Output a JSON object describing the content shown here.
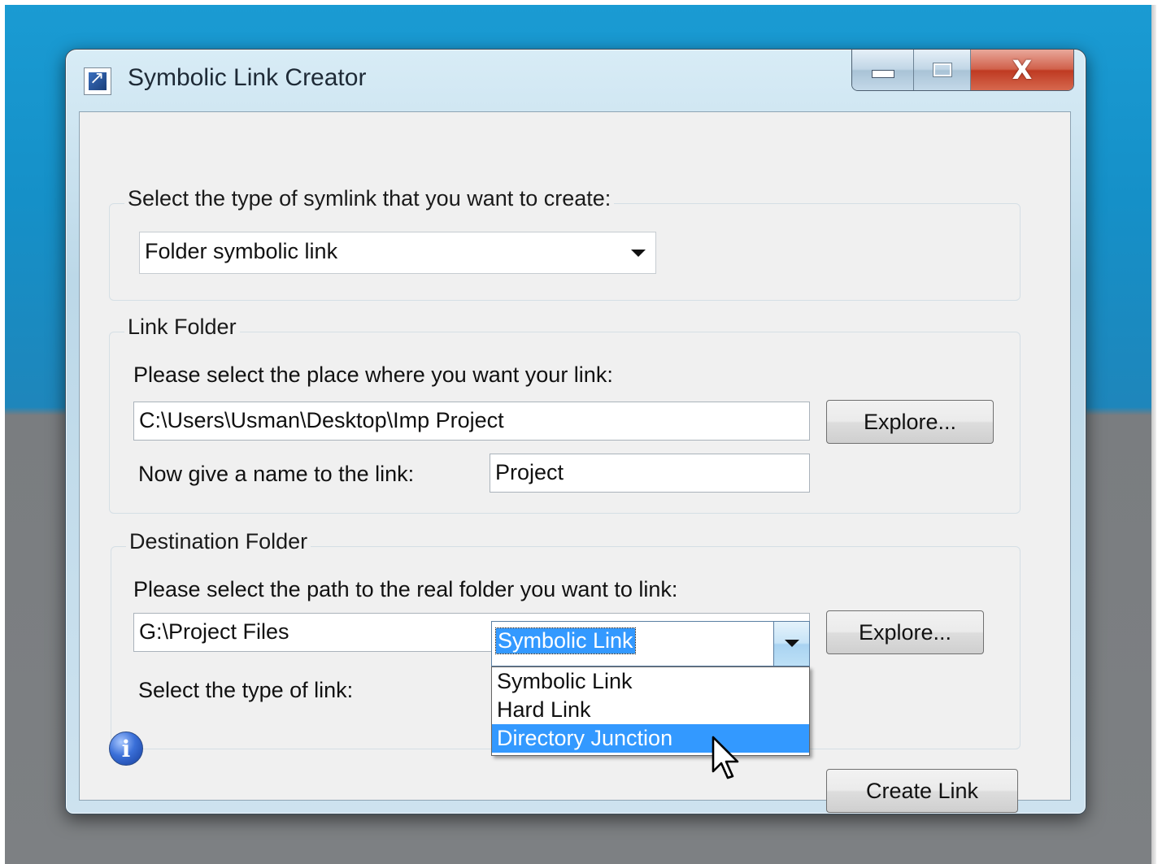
{
  "window": {
    "title": "Symbolic Link Creator",
    "icons": {
      "app": "shortcut-arrow-icon",
      "minimize": "minimize-icon",
      "maximize": "maximize-icon",
      "close": "close-icon"
    },
    "close_glyph": "X"
  },
  "symlink_type": {
    "group_label": "Select the type of symlink that you want to create:",
    "selected": "Folder symbolic link"
  },
  "link_folder": {
    "group_label": "Link Folder",
    "prompt": "Please select the place where you want your link:",
    "path_value": "C:\\Users\\Usman\\Desktop\\Imp Project",
    "explore_label": "Explore...",
    "name_prompt": "Now give a name to the link:",
    "name_value": "Project"
  },
  "destination_folder": {
    "group_label": "Destination Folder",
    "prompt": "Please select the path to the real folder you want to link:",
    "path_value": "G:\\Project Files",
    "explore_label": "Explore...",
    "link_type_prompt": "Select the type of link:",
    "link_type_selected": "Symbolic Link",
    "link_type_options": [
      "Symbolic Link",
      "Hard Link",
      "Directory Junction"
    ],
    "highlighted_option": "Directory Junction"
  },
  "footer": {
    "info_icon": "info-icon",
    "info_glyph": "i",
    "create_label": "Create Link"
  },
  "colors": {
    "selection": "#3399ff",
    "desktop_top": "#1a9bd3",
    "desktop_bottom": "#7d8083",
    "close_button": "#c9462e"
  }
}
